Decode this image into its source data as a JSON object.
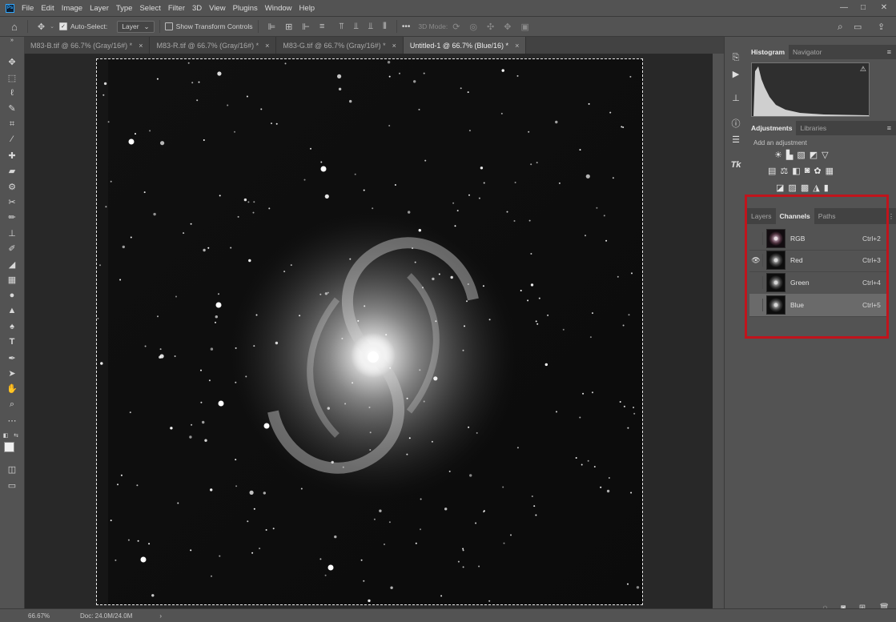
{
  "menubar": {
    "app_logo": "Ps",
    "items": [
      "File",
      "Edit",
      "Image",
      "Layer",
      "Type",
      "Select",
      "Filter",
      "3D",
      "View",
      "Plugins",
      "Window",
      "Help"
    ]
  },
  "window_controls": {
    "minimize": "—",
    "maximize": "□",
    "close": "✕"
  },
  "options_bar": {
    "auto_select_label": "Auto-Select:",
    "auto_select_checked": true,
    "auto_select_target": "Layer",
    "show_transform_label": "Show Transform Controls",
    "show_transform_checked": false,
    "mode_3d_label": "3D Mode:",
    "more_label": "•••"
  },
  "tabs": [
    {
      "label": "M83-B.tif @ 66.7% (Gray/16#) *",
      "active": false
    },
    {
      "label": "M83-R.tif @ 66.7% (Gray/16#) *",
      "active": false
    },
    {
      "label": "M83-G.tif @ 66.7% (Gray/16#) *",
      "active": false
    },
    {
      "label": "Untitled-1 @ 66.7% (Blue/16) *",
      "active": true
    }
  ],
  "tab_close_glyph": "×",
  "panels": {
    "top_tabs": [
      {
        "label": "Histogram",
        "active": true
      },
      {
        "label": "Navigator",
        "active": false
      }
    ],
    "adjust_tabs": [
      {
        "label": "Adjustments",
        "active": true
      },
      {
        "label": "Libraries",
        "active": false
      }
    ],
    "add_adjustment": "Add an adjustment",
    "channel_tabs": [
      {
        "label": "Layers",
        "active": false
      },
      {
        "label": "Channels",
        "active": true
      },
      {
        "label": "Paths",
        "active": false
      }
    ],
    "channels": [
      {
        "name": "RGB",
        "shortcut": "Ctrl+2",
        "visible": false,
        "selected": false
      },
      {
        "name": "Red",
        "shortcut": "Ctrl+3",
        "visible": true,
        "selected": false
      },
      {
        "name": "Green",
        "shortcut": "Ctrl+4",
        "visible": false,
        "selected": false
      },
      {
        "name": "Blue",
        "shortcut": "Ctrl+5",
        "visible": false,
        "selected": true
      }
    ]
  },
  "status_bar": {
    "zoom": "66.67%",
    "doc": "Doc: 24.0M/24.0M",
    "arrow": "›"
  },
  "colors": {
    "highlight_box": "#c0141c",
    "ui_bg": "#535353",
    "canvas_bg": "#282828"
  }
}
